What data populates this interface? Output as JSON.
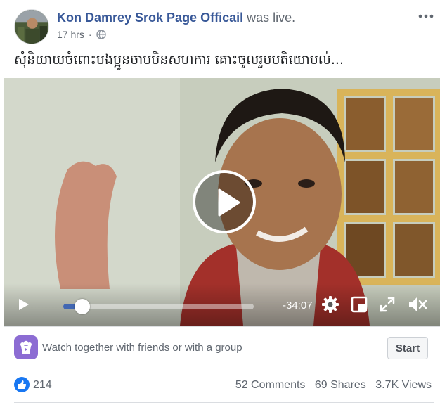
{
  "post": {
    "author": "Kon Damrey Srok Page Officail",
    "action": "was live.",
    "time": "17 hrs",
    "privacy_icon": "globe-icon",
    "caption": "សុំនិយាយចំពោះបងប្អូនចាមមិនសហការ គោះចូលរួមមតិយោបល់..."
  },
  "video": {
    "elapsed_fraction": 0.1,
    "time_remaining": "-34:07",
    "accent": "#4267b2"
  },
  "watch_party": {
    "text": "Watch together with friends or with a group",
    "button": "Start",
    "icon_color": "#8c6cd3"
  },
  "stats": {
    "likes": "214",
    "comments": "52 Comments",
    "shares": "69 Shares",
    "views": "3.7K Views"
  },
  "colors": {
    "link": "#385898",
    "like": "#1877f2"
  }
}
